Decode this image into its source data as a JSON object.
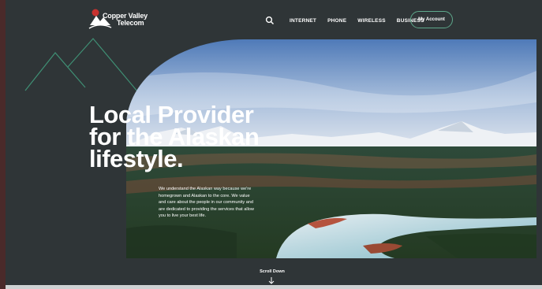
{
  "brand": {
    "line1": "Copper Valley",
    "line2": "Telecom"
  },
  "nav": {
    "search_icon": "search-icon",
    "items": [
      "INTERNET",
      "PHONE",
      "WIRELESS",
      "BUSINESS"
    ],
    "account_label": "My Account"
  },
  "hero": {
    "headline_lines": [
      "Local Provider",
      "for the Alaskan",
      "lifestyle."
    ],
    "description": "We understand the Alaskan way because we're homegrown and Alaskan to the core. We value and care about the people in our community and are dedicated to providing the services that allow you to live your best life."
  },
  "scroll": {
    "label": "Scroll Down",
    "icon": "arrow-down-icon"
  },
  "colors": {
    "background": "#2f3537",
    "accent": "#5ea88b",
    "logo_red": "#c8322f"
  }
}
